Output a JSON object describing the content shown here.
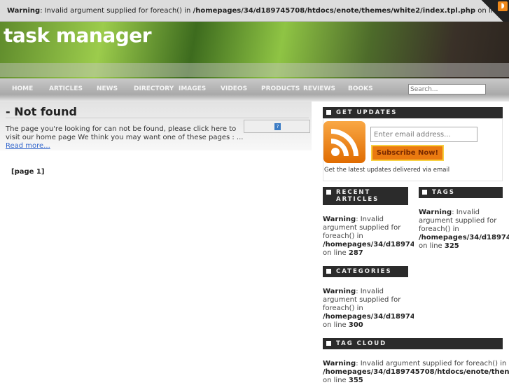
{
  "top_warning": {
    "label": "Warning",
    "text": ": Invalid argument supplied for foreach() in ",
    "path": "/homepages/34/d189745708/htdocs/enote/themes/white2/index.tpl.php",
    "tail": " on li"
  },
  "site_title": "task manager",
  "nav": [
    "HOME",
    "ARTICLES",
    "NEWS",
    "DIRECTORY",
    "IMAGES",
    "VIDEOS",
    "PRODUCTS",
    "REVIEWS",
    "BOOKS"
  ],
  "search_placeholder": "Search...",
  "main": {
    "title": "- Not found",
    "text": "The page you're looking for can not be found, please click here to visit our home page We think you may want one of these pages : ... ",
    "read_more": "Read more...",
    "pager": "[page 1]",
    "help_icon": "?"
  },
  "sidebar": {
    "get_updates": {
      "title": "GET UPDATES",
      "email_placeholder": "Enter email address...",
      "button": "Subscribe Now!",
      "note": "Get the latest updates delivered via email"
    },
    "recent": {
      "title1": "RECENT",
      "title2": "ARTICLES",
      "w1": "Warning",
      "t1": ": Invalid",
      "t2": "argument supplied for",
      "t3": "foreach() in",
      "path": "/homepages/34/d18974",
      "t4": "on line ",
      "line": "287"
    },
    "tags": {
      "title": "TAGS",
      "w1": "Warning",
      "t1": ": Invalid",
      "t2": "argument supplied for",
      "t3": "foreach() in",
      "path": "/homepages/34/d18974",
      "t4": "on line ",
      "line": "325"
    },
    "categories": {
      "title": "CATEGORIES",
      "w1": "Warning",
      "t1": ": Invalid",
      "t2": "argument supplied for",
      "t3": "foreach() in",
      "path": "/homepages/34/d18974",
      "t4": "on line ",
      "line": "300"
    },
    "tag_cloud": {
      "title": "TAG CLOUD",
      "w1": "Warning",
      "t1": ": Invalid argument supplied for foreach() in",
      "path": "/homepages/34/d189745708/htdocs/enote/then",
      "t4": "on line ",
      "line": "355"
    }
  }
}
